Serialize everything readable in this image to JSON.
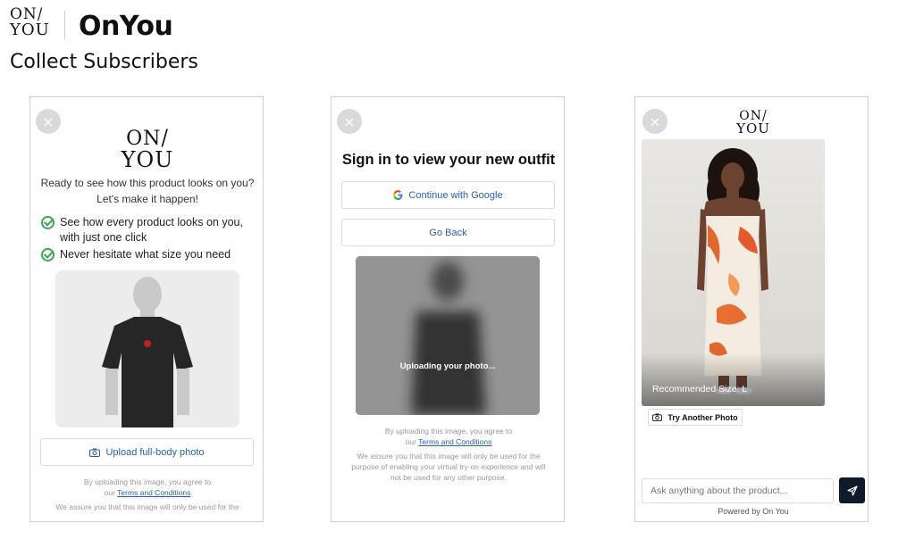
{
  "brand": {
    "logo_top": "ON",
    "logo_bottom": "YOU",
    "logo_slash": "/",
    "name": "OnYou"
  },
  "page_subtitle": "Collect Subscribers",
  "screen1": {
    "close_glyph": "×",
    "heading": "Ready to see how this product looks on you?",
    "subheading": "Let's make it happen!",
    "benefits": [
      "See how every product looks on you, with just one click",
      "Never hesitate what size you need"
    ],
    "upload_button": "Upload full-body photo",
    "legal_line1": "By uploading this image, you agree to",
    "legal_our": "our",
    "terms_link": "Terms and Conditions",
    "legal_line2": "We assure you that this image will only be used for the"
  },
  "screen2": {
    "close_glyph": "×",
    "title": "Sign in to view your new outfit",
    "google_button": "Continue with Google",
    "back_button": "Go Back",
    "uploading_text": "Uploading your photo...",
    "legal_line1": "By uploading this image, you agree to",
    "legal_our": "our",
    "terms_link": "Terms and Conditions",
    "legal_line2": "We assure you that this image will only be used for the",
    "legal_line3": "purpose of enabling your virtual try-on experience and will",
    "legal_line4": "not be used for any other purpose."
  },
  "screen3": {
    "close_glyph": "×",
    "recommended_size": "Recommended Size: L",
    "try_another": "Try Another Photo",
    "chat_placeholder": "Ask anything about the product...",
    "powered_by": "Powered by On You"
  },
  "colors": {
    "accent_blue": "#2a5db0",
    "check_green": "#3aa655",
    "send_button": "#0f1b2d"
  }
}
